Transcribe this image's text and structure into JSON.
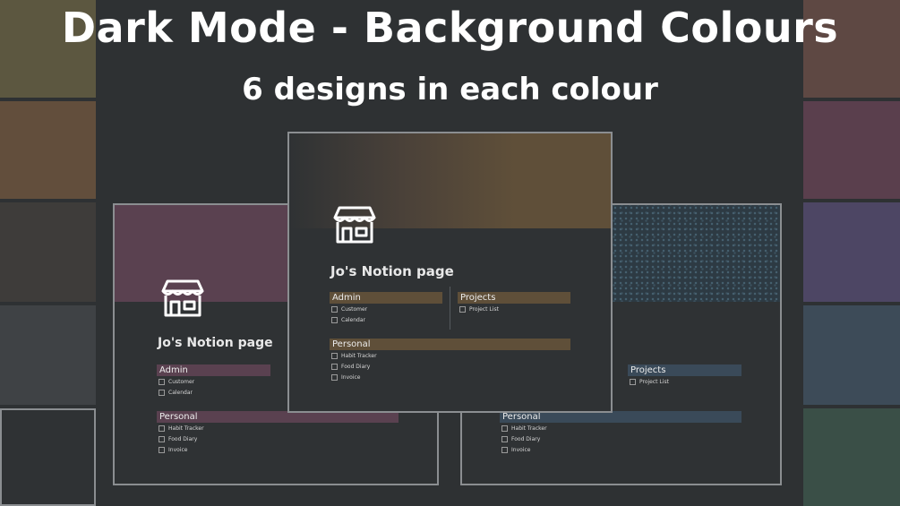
{
  "header": {
    "title": "Dark Mode - Background Colours",
    "subtitle": "6 designs in each colour"
  },
  "colors": {
    "background": "#2e3133",
    "left_swatches": [
      "#5c5740",
      "#624e3c",
      "#3e3c3a",
      "#3f4245",
      "#2f3234"
    ],
    "right_swatches": [
      "#5e4843",
      "#5a3f4d",
      "#4d4664",
      "#3d4b58",
      "#3a4f47"
    ],
    "pink_accent": "#5a4150",
    "brown_accent": "#5f4f39",
    "blue_accent": "#3a4a59"
  },
  "cards": {
    "left": {
      "page_title": "Jo's Notion page",
      "admin_label": "Admin",
      "admin_items": [
        "Customer",
        "Calendar"
      ],
      "personal_label": "Personal",
      "personal_items": [
        "Habit Tracker",
        "Food Diary",
        "Invoice"
      ]
    },
    "center": {
      "page_title": "Jo's Notion page",
      "admin_label": "Admin",
      "admin_items": [
        "Customer",
        "Calendar"
      ],
      "projects_label": "Projects",
      "projects_items": [
        "Project List"
      ],
      "personal_label": "Personal",
      "personal_items": [
        "Habit Tracker",
        "Food Diary",
        "Invoice"
      ]
    },
    "right": {
      "projects_label": "Projects",
      "projects_items": [
        "Project List"
      ],
      "personal_label": "Personal",
      "personal_items": [
        "Habit Tracker",
        "Food Diary",
        "Invoice"
      ]
    }
  }
}
